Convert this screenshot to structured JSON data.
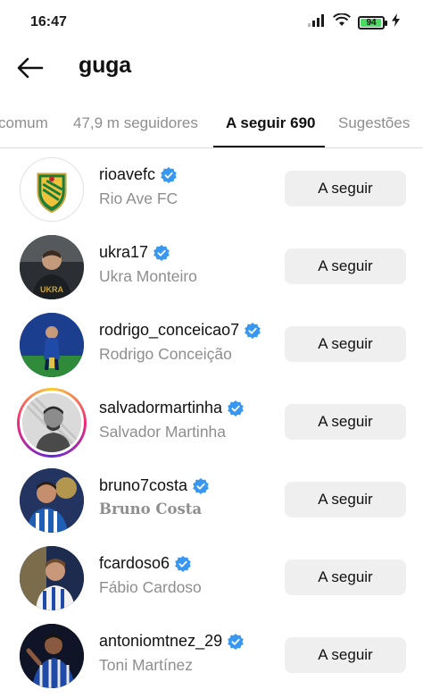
{
  "status_bar": {
    "time": "16:47",
    "battery_level": "94"
  },
  "header": {
    "title": "guga"
  },
  "tabs": [
    {
      "label": "comum"
    },
    {
      "label": "47,9 m seguidores"
    },
    {
      "label": "A seguir 690"
    },
    {
      "label": "Sugestões"
    }
  ],
  "active_tab": "A seguir 690",
  "accounts": [
    {
      "username": "rioavefc",
      "full_name": "Rio Ave FC",
      "verified": true,
      "button": "A seguir"
    },
    {
      "username": "ukra17",
      "full_name": "Ukra Monteiro",
      "verified": true,
      "button": "A seguir"
    },
    {
      "username": "rodrigo_conceicao7",
      "full_name": "Rodrigo Conceição",
      "verified": true,
      "button": "A seguir"
    },
    {
      "username": "salvadormartinha",
      "full_name": "Salvador Martinha",
      "verified": true,
      "button": "A seguir"
    },
    {
      "username": "bruno7costa",
      "full_name": "Bruno Costa",
      "verified": true,
      "button": "A seguir"
    },
    {
      "username": "fcardoso6",
      "full_name": "Fábio Cardoso",
      "verified": true,
      "button": "A seguir"
    },
    {
      "username": "antoniomtnez_29",
      "full_name": "Toni Martínez",
      "verified": true,
      "button": "A seguir"
    }
  ],
  "colors": {
    "verified_badge": "#3897f0",
    "button_bg": "#efefef",
    "secondary_text": "#8e8e8e",
    "battery_fill": "#4cd964"
  }
}
